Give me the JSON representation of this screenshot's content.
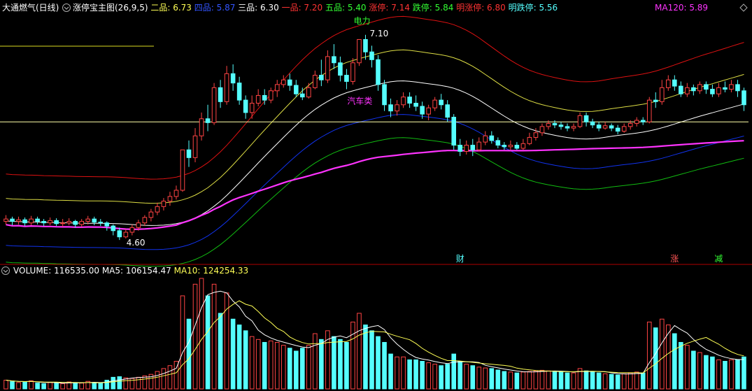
{
  "header": {
    "stock_name": "大通燃气(日线)",
    "indicator_name": "涨停宝主图(26,9,5)",
    "levels": [
      {
        "label": "二品: ",
        "value": "6.73",
        "color": "#ffff55"
      },
      {
        "label": "四品: ",
        "value": "5.87",
        "color": "#3355ff"
      },
      {
        "label": "三品: ",
        "value": "6.30",
        "color": "#ffffff"
      },
      {
        "label": "一品: ",
        "value": "7.20",
        "color": "#ff3333"
      },
      {
        "label": "五品: ",
        "value": "5.40",
        "color": "#33ff33"
      },
      {
        "label": "涨停: ",
        "value": "7.14",
        "color": "#ff3333"
      },
      {
        "label": "跌停: ",
        "value": "5.84",
        "color": "#33ff33"
      },
      {
        "label": "明涨停: ",
        "value": "6.80",
        "color": "#ff3333"
      },
      {
        "label": "明跌停: ",
        "value": "5.56",
        "color": "#55ffff"
      }
    ],
    "ma_label": "MA120: ",
    "ma_value": "5.89",
    "ma_color": "#ff33ff"
  },
  "volume_header": {
    "vol_label": "VOLUME: ",
    "vol_value": "116535.00",
    "ma5_label": "MA5: ",
    "ma5_value": "106154.47",
    "ma10_label": "MA10: ",
    "ma10_value": "124254.33"
  },
  "annotations": {
    "high_text": "7.10",
    "low_text": "4.60",
    "sector_power": "电力",
    "sector_auto": "汽车类",
    "marker_cai": "财",
    "marker_zhang": "涨",
    "marker_jian": "减"
  },
  "colors": {
    "up": "#ff4444",
    "down": "#55ffff",
    "ma120": "#ff33ff",
    "line_red": "#dd1111",
    "line_yellow": "#dddd44",
    "line_blue": "#1133ee",
    "line_green": "#11bb11",
    "line_white": "#ffffff"
  },
  "chart_data": {
    "type": "candlestick",
    "price_range": [
      4.3,
      7.45
    ],
    "volume_max": 380,
    "candles": [
      [
        4.8,
        4.83,
        4.76,
        4.88,
        30
      ],
      [
        4.83,
        4.8,
        4.75,
        4.86,
        25
      ],
      [
        4.8,
        4.82,
        4.76,
        4.86,
        22
      ],
      [
        4.82,
        4.78,
        4.74,
        4.85,
        24
      ],
      [
        4.78,
        4.83,
        4.75,
        4.87,
        28
      ],
      [
        4.83,
        4.8,
        4.76,
        4.86,
        20
      ],
      [
        4.8,
        4.78,
        4.74,
        4.83,
        18
      ],
      [
        4.78,
        4.81,
        4.75,
        4.85,
        22
      ],
      [
        4.81,
        4.77,
        4.74,
        4.84,
        20
      ],
      [
        4.77,
        4.78,
        4.73,
        4.83,
        18
      ],
      [
        4.78,
        4.8,
        4.75,
        4.84,
        24
      ],
      [
        4.8,
        4.76,
        4.72,
        4.82,
        22
      ],
      [
        4.76,
        4.8,
        4.73,
        4.83,
        20
      ],
      [
        4.8,
        4.83,
        4.76,
        4.87,
        26
      ],
      [
        4.83,
        4.79,
        4.75,
        4.86,
        22
      ],
      [
        4.79,
        4.78,
        4.74,
        4.83,
        20
      ],
      [
        4.78,
        4.74,
        4.68,
        4.8,
        30
      ],
      [
        4.74,
        4.68,
        4.62,
        4.76,
        40
      ],
      [
        4.68,
        4.6,
        4.56,
        4.72,
        42
      ],
      [
        4.6,
        4.66,
        4.58,
        4.7,
        38
      ],
      [
        4.66,
        4.72,
        4.62,
        4.76,
        36
      ],
      [
        4.72,
        4.78,
        4.68,
        4.82,
        40
      ],
      [
        4.78,
        4.85,
        4.74,
        4.88,
        45
      ],
      [
        4.85,
        4.92,
        4.8,
        4.96,
        50
      ],
      [
        4.92,
        4.99,
        4.88,
        5.04,
        60
      ],
      [
        4.99,
        5.06,
        4.94,
        5.1,
        70
      ],
      [
        5.06,
        5.12,
        5.0,
        5.18,
        80
      ],
      [
        5.12,
        5.2,
        5.08,
        5.26,
        95
      ],
      [
        5.2,
        5.72,
        5.18,
        5.72,
        320
      ],
      [
        5.72,
        5.62,
        5.5,
        5.84,
        240
      ],
      [
        5.62,
        5.9,
        5.56,
        6.0,
        360
      ],
      [
        5.9,
        6.12,
        5.84,
        6.2,
        380
      ],
      [
        6.12,
        6.07,
        5.96,
        6.3,
        320
      ],
      [
        6.07,
        6.52,
        6.04,
        6.58,
        360
      ],
      [
        6.52,
        6.34,
        6.26,
        6.62,
        260
      ],
      [
        6.34,
        6.7,
        6.3,
        6.8,
        330
      ],
      [
        6.7,
        6.58,
        6.48,
        6.82,
        240
      ],
      [
        6.58,
        6.36,
        6.3,
        6.66,
        220
      ],
      [
        6.36,
        6.2,
        6.12,
        6.42,
        200
      ],
      [
        6.2,
        6.32,
        6.12,
        6.42,
        180
      ],
      [
        6.32,
        6.42,
        6.28,
        6.5,
        170
      ],
      [
        6.42,
        6.36,
        6.3,
        6.5,
        160
      ],
      [
        6.36,
        6.48,
        6.32,
        6.52,
        165
      ],
      [
        6.48,
        6.56,
        6.4,
        6.62,
        160
      ],
      [
        6.56,
        6.62,
        6.52,
        6.68,
        150
      ],
      [
        6.62,
        6.55,
        6.48,
        6.7,
        140
      ],
      [
        6.55,
        6.44,
        6.4,
        6.62,
        130
      ],
      [
        6.44,
        6.4,
        6.36,
        6.52,
        140
      ],
      [
        6.4,
        6.52,
        6.38,
        6.58,
        150
      ],
      [
        6.52,
        6.68,
        6.5,
        6.74,
        190
      ],
      [
        6.68,
        6.62,
        6.54,
        6.88,
        170
      ],
      [
        6.62,
        6.92,
        6.58,
        7.0,
        200
      ],
      [
        6.92,
        6.84,
        6.76,
        7.08,
        180
      ],
      [
        6.84,
        6.68,
        6.6,
        6.92,
        170
      ],
      [
        6.68,
        6.6,
        6.5,
        6.76,
        160
      ],
      [
        6.6,
        6.84,
        6.56,
        6.9,
        230
      ],
      [
        6.84,
        7.14,
        6.8,
        7.14,
        260
      ],
      [
        7.14,
        6.98,
        6.88,
        7.2,
        220
      ],
      [
        6.98,
        6.88,
        6.78,
        7.06,
        200
      ],
      [
        6.88,
        6.56,
        6.48,
        6.94,
        180
      ],
      [
        6.56,
        6.3,
        6.22,
        6.62,
        160
      ],
      [
        6.3,
        6.22,
        6.14,
        6.38,
        120
      ],
      [
        6.22,
        6.3,
        6.16,
        6.36,
        110
      ],
      [
        6.3,
        6.4,
        6.26,
        6.46,
        110
      ],
      [
        6.4,
        6.32,
        6.26,
        6.46,
        100
      ],
      [
        6.32,
        6.28,
        6.22,
        6.42,
        100
      ],
      [
        6.28,
        6.18,
        6.12,
        6.34,
        95
      ],
      [
        6.18,
        6.26,
        6.1,
        6.3,
        90
      ],
      [
        6.26,
        6.36,
        6.22,
        6.4,
        85
      ],
      [
        6.36,
        6.3,
        6.24,
        6.44,
        80
      ],
      [
        6.3,
        6.14,
        6.08,
        6.36,
        85
      ],
      [
        6.14,
        5.78,
        5.72,
        6.18,
        120
      ],
      [
        5.78,
        5.7,
        5.64,
        5.86,
        95
      ],
      [
        5.7,
        5.78,
        5.66,
        5.84,
        85
      ],
      [
        5.78,
        5.72,
        5.64,
        5.86,
        80
      ],
      [
        5.72,
        5.82,
        5.7,
        5.88,
        75
      ],
      [
        5.82,
        5.9,
        5.78,
        5.96,
        72
      ],
      [
        5.9,
        5.84,
        5.8,
        5.96,
        70
      ],
      [
        5.84,
        5.78,
        5.74,
        5.88,
        65
      ],
      [
        5.78,
        5.76,
        5.72,
        5.82,
        60
      ],
      [
        5.76,
        5.78,
        5.72,
        5.84,
        58
      ],
      [
        5.78,
        5.74,
        5.72,
        5.82,
        55
      ],
      [
        5.74,
        5.8,
        5.72,
        5.86,
        58
      ],
      [
        5.8,
        5.88,
        5.78,
        5.94,
        60
      ],
      [
        5.88,
        5.94,
        5.84,
        6.0,
        62
      ],
      [
        5.94,
        6.02,
        5.9,
        6.06,
        64
      ],
      [
        6.02,
        6.06,
        5.98,
        6.1,
        62
      ],
      [
        6.06,
        6.04,
        6.0,
        6.1,
        60
      ],
      [
        6.04,
        6.02,
        5.98,
        6.08,
        58
      ],
      [
        6.02,
        6.0,
        5.96,
        6.06,
        55
      ],
      [
        6.0,
        6.02,
        5.96,
        6.06,
        55
      ],
      [
        6.02,
        6.16,
        6.0,
        6.2,
        70
      ],
      [
        6.16,
        6.08,
        6.02,
        6.2,
        62
      ],
      [
        6.08,
        6.04,
        6.0,
        6.12,
        58
      ],
      [
        6.04,
        6.0,
        5.96,
        6.08,
        55
      ],
      [
        6.0,
        6.03,
        5.98,
        6.08,
        52
      ],
      [
        6.03,
        6.0,
        5.96,
        6.06,
        50
      ],
      [
        6.0,
        5.96,
        5.92,
        6.04,
        48
      ],
      [
        5.96,
        6.02,
        5.94,
        6.06,
        52
      ],
      [
        6.02,
        6.06,
        5.98,
        6.1,
        55
      ],
      [
        6.06,
        6.1,
        6.02,
        6.14,
        58
      ],
      [
        6.1,
        6.08,
        6.04,
        6.14,
        55
      ],
      [
        6.08,
        6.36,
        6.06,
        6.4,
        230
      ],
      [
        6.36,
        6.34,
        6.26,
        6.46,
        210
      ],
      [
        6.34,
        6.52,
        6.3,
        6.62,
        240
      ],
      [
        6.52,
        6.62,
        6.48,
        6.68,
        220
      ],
      [
        6.62,
        6.54,
        6.48,
        6.68,
        190
      ],
      [
        6.54,
        6.44,
        6.4,
        6.6,
        160
      ],
      [
        6.44,
        6.52,
        6.4,
        6.58,
        150
      ],
      [
        6.52,
        6.48,
        6.42,
        6.56,
        130
      ],
      [
        6.48,
        6.56,
        6.44,
        6.6,
        125
      ],
      [
        6.56,
        6.5,
        6.44,
        6.6,
        115
      ],
      [
        6.5,
        6.44,
        6.4,
        6.56,
        110
      ],
      [
        6.44,
        6.52,
        6.4,
        6.58,
        100
      ],
      [
        6.52,
        6.5,
        6.46,
        6.6,
        95
      ],
      [
        6.5,
        6.56,
        6.46,
        6.62,
        100
      ],
      [
        6.56,
        6.48,
        6.4,
        6.62,
        100
      ],
      [
        6.48,
        6.3,
        6.22,
        6.52,
        110
      ]
    ]
  }
}
